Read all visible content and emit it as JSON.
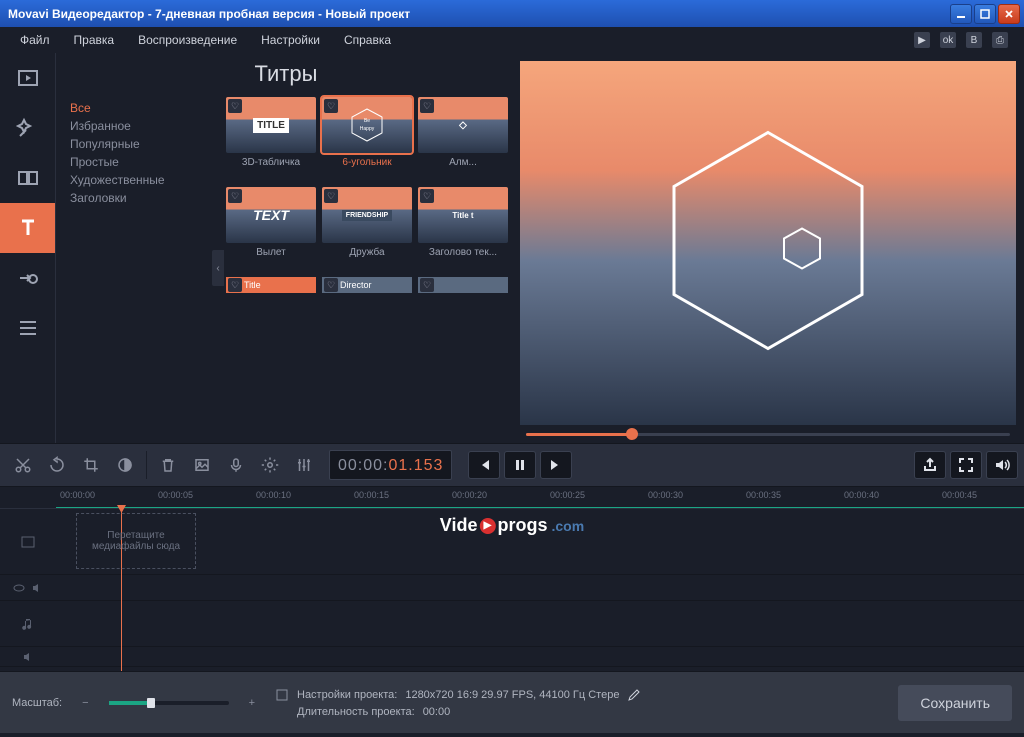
{
  "window": {
    "title": "Movavi Видеоредактор - 7-дневная пробная версия - Новый проект"
  },
  "menu": [
    "Файл",
    "Правка",
    "Воспроизведение",
    "Настройки",
    "Справка"
  ],
  "panel": {
    "title": "Титры",
    "categories": [
      "Все",
      "Избранное",
      "Популярные",
      "Простые",
      "Художественные",
      "Заголовки"
    ],
    "selected_category": 0
  },
  "thumbs": [
    [
      {
        "label": "3D-табличка",
        "text": "TITLE"
      },
      {
        "label": "6-угольник",
        "text": "Be Happy",
        "selected": true
      },
      {
        "label": "Алм...",
        "text": "◇"
      }
    ],
    [
      {
        "label": "Вылет",
        "text": "TEXT"
      },
      {
        "label": "Дружба",
        "text": "FRIENDSHIP"
      },
      {
        "label": "Заголово тек...",
        "text": "Title t"
      }
    ],
    [
      {
        "small": true,
        "text": "Title"
      },
      {
        "small": true,
        "text": "Director"
      },
      {
        "small": true,
        "text": ""
      }
    ]
  ],
  "timecode": {
    "part1": "00:00:",
    "part2": "01.153"
  },
  "ruler": [
    "00:00:00",
    "00:00:05",
    "00:00:10",
    "00:00:15",
    "00:00:20",
    "00:00:25",
    "00:00:30",
    "00:00:35",
    "00:00:40",
    "00:00:45"
  ],
  "dropzone": "Перетащите медиафайлы сюда",
  "watermark": {
    "pre": "Vide",
    "post": "progs",
    "ext": ".com"
  },
  "footer": {
    "zoom_label": "Масштаб:",
    "settings_label": "Настройки проекта:",
    "settings_value": "1280x720 16:9 29.97 FPS, 44100 Гц Стере",
    "duration_label": "Длительность проекта:",
    "duration_value": "00:00",
    "save": "Сохранить"
  }
}
